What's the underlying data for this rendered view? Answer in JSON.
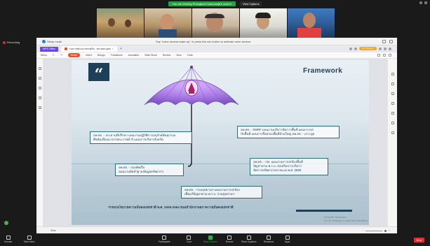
{
  "zoom": {
    "share_banner": "You are viewing Phongkod Chanumajit's screen",
    "view_options": "View Options",
    "recording": "Recording",
    "participants": [
      {
        "name": ""
      },
      {
        "name": ""
      },
      {
        "name": ""
      },
      {
        "name": ""
      },
      {
        "name": ""
      }
    ],
    "toolbar": {
      "unmute": "Unmute",
      "start_video": "Start Video",
      "participants": "Participants",
      "participants_count": "12",
      "chat": "Chat",
      "share_screen": "Share Screen",
      "record": "Record",
      "show_captions": "Show Captions",
      "reactions": "Reactions",
      "apps": "Apps",
      "end": "End"
    }
  },
  "wps": {
    "app_name": "Sleep mode",
    "hint": "Say \"voice access wake up\" or press the mic button to activate voice access.",
    "badge": "WPS Office",
    "doc_tab": "รายงานสัมมนาเศรษฐกิจ...ขยายผล.pptx",
    "pill": "Go Premium",
    "ribbon": [
      "Menu",
      "Home",
      "Insert",
      "Design",
      "Transitions",
      "Animation",
      "Slide Show",
      "Review",
      "View",
      "Tools"
    ],
    "ribbon_active": "Home",
    "status_page": "Slide",
    "watermark_line1": "Activate Windows",
    "watermark_line2": "Go to Settings to activate Windows."
  },
  "slide": {
    "quote_mark": "“",
    "title": "Framework",
    "box_left_top": "อพ.สธ. - ประธานที่ปรึกษา แผนงานปฏิบัติการอนุรักษ์พันธุกรรม\nพืชอันเนื่องมาจากพระราชดำริ แผนการบริหารจังหวัด",
    "box_right_top": "อพ.สธ. - SMRF แผนงานบริหารจัดการพื้นที่ แผนการปก\nปักพื้นที่ แผนการถือครองพื้นที่ส่วนใหญ่ อพ.สธ. - เกาะกูด",
    "box_left_mid": "อพ.สธ. - กองทัพเรือ\nแผนงานจัดทำฐานข้อมูลทรัพยากร",
    "box_right_mid": "อพ.สธ. - กฟ. แผนงานการปกป้องพื้นที่\nปัญหาตาม พ.ร.บ. ส่งเสริมการบริหาร\nจัดการทรัพยากรทางทะเล พ.ศ. 2558",
    "box_center_bottom": "อพ.สธ. - กรมอุทยานฯ แผนงานการปกป้อง\nเพื่อแก้ปัญหาตาม พ.ร.บ. กรมอุทยานฯ",
    "footnote": "*กรอบนโยบายความมั่นคงแห่งชาติ พ.ศ. 2558-2564 ของสำนักงานสภาความมั่นคงแห่งชาติ"
  }
}
